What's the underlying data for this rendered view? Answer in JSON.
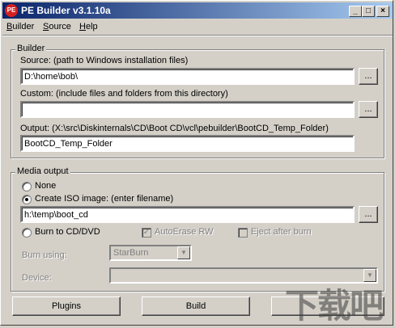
{
  "window": {
    "title": "PE Builder v3.1.10a",
    "app_icon_text": "PE",
    "controls": {
      "minimize": "_",
      "maximize": "□",
      "close": "×"
    }
  },
  "menu": [
    {
      "label": "Builder"
    },
    {
      "label": "Source"
    },
    {
      "label": "Help"
    }
  ],
  "builder": {
    "group_label": "Builder",
    "source": {
      "label": "Source: (path to Windows installation files)",
      "value": "D:\\home\\bob\\",
      "browse": "..."
    },
    "custom": {
      "label": "Custom: (include files and folders from this directory)",
      "value": "",
      "browse": "..."
    },
    "output": {
      "label": "Output: (X:\\src\\Diskinternals\\CD\\Boot CD\\vcl\\pebuilder\\BootCD_Temp_Folder)",
      "value": "BootCD_Temp_Folder"
    }
  },
  "media": {
    "group_label": "Media output",
    "none_label": "None",
    "iso_label": "Create ISO image: (enter filename)",
    "iso_value": "h:\\temp\\boot_cd",
    "iso_browse": "...",
    "burn_label": "Burn to CD/DVD",
    "autoerase_label": "AutoErase RW",
    "autoerase_checked": true,
    "eject_label": "Eject after burn",
    "eject_checked": false,
    "burn_using_label": "Burn using:",
    "burn_using_value": "StarBurn",
    "device_label": "Device:",
    "device_value": "",
    "selected": "iso"
  },
  "buttons": {
    "plugins": "Plugins",
    "build": "Build"
  },
  "watermark": "下载吧"
}
